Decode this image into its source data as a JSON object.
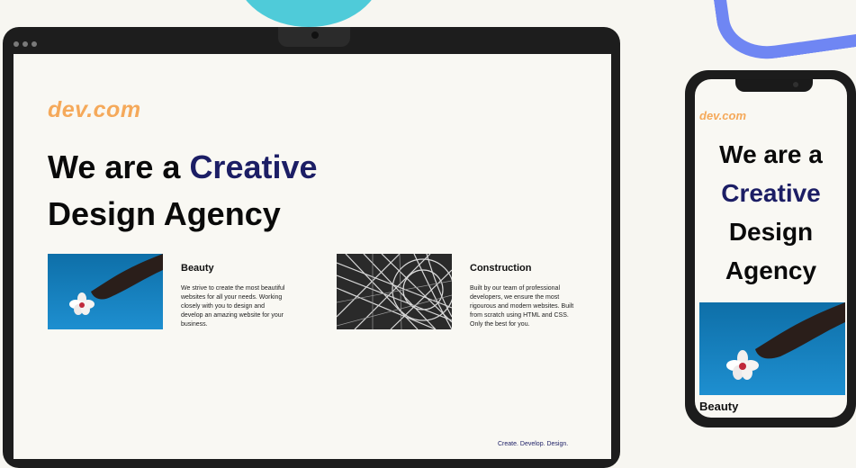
{
  "laptop": {
    "logo": "dev.com",
    "hero": {
      "line1_prefix": "We are a ",
      "line1_accent": "Creative",
      "line2": "Design Agency"
    },
    "cards": [
      {
        "title": "Beauty",
        "text": "We strive to create the most beautiful websites for all your needs. Working closely with you to design and develop an amazing website for your business."
      },
      {
        "title": "Construction",
        "text": "Built by our team of professional developers, we ensure the most rigourous and modern websites. Built from scratch using HTML and CSS. Only the best for you."
      }
    ],
    "tagline": "Create. Develop. Design."
  },
  "phone": {
    "logo": "dev.com",
    "hero_lines": [
      "We are a",
      "Creative",
      "Design",
      "Agency"
    ],
    "card_title": "Beauty"
  },
  "colors": {
    "logo": "#f5a95a",
    "accent": "#1c1e65",
    "background": "#f7f6f1"
  }
}
